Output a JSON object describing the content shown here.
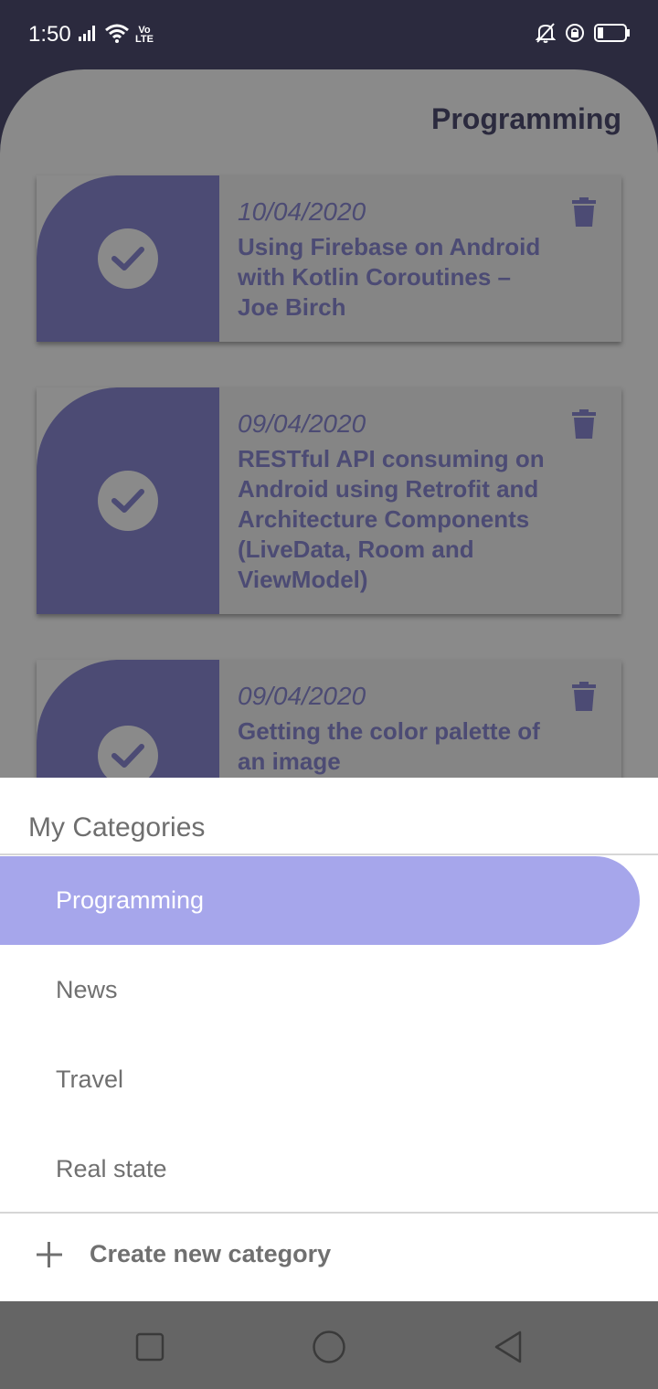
{
  "status_bar": {
    "time": "1:50",
    "volte_top": "Vo",
    "volte_bottom": "LTE",
    "icons": [
      "signal-icon",
      "wifi-icon",
      "volte-icon",
      "mute-bell-icon",
      "rotation-lock-icon",
      "battery-icon"
    ]
  },
  "main": {
    "title": "Programming",
    "cards": [
      {
        "date": "10/04/2020",
        "title": "Using Firebase on Android with Kotlin Coroutines – Joe Birch"
      },
      {
        "date": "09/04/2020",
        "title": "RESTful API consuming on Android using Retrofit and Architecture Components (LiveData, Room and ViewModel)"
      },
      {
        "date": "09/04/2020",
        "title": "Getting the color palette of an image"
      }
    ]
  },
  "drawer": {
    "header": "My Categories",
    "items": [
      {
        "label": "Programming",
        "selected": true
      },
      {
        "label": "News",
        "selected": false
      },
      {
        "label": "Travel",
        "selected": false
      },
      {
        "label": "Real state",
        "selected": false
      }
    ],
    "create_label": "Create new category"
  },
  "colors": {
    "accent": "#a6a6eb",
    "card_accent": "#4c4b74",
    "status_bar": "#2b2a3e",
    "scrim_gray": "#8a8a8a"
  },
  "nav_bar": {
    "icons": [
      "recents-square-icon",
      "home-circle-icon",
      "back-triangle-icon"
    ]
  }
}
